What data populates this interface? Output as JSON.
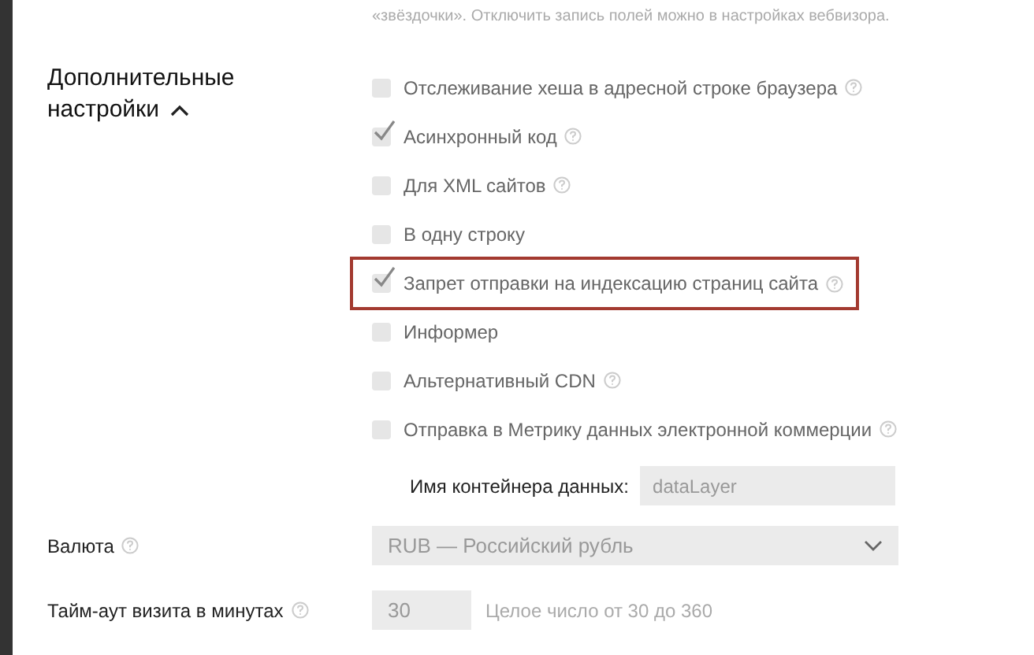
{
  "top_note": "«звёздочки». Отключить запись полей можно в настройках вебвизора.",
  "section": {
    "title": "Дополнительные настройки",
    "expanded": true
  },
  "options": [
    {
      "label": "Отслеживание хеша в адресной строке браузера",
      "checked": false,
      "help": true,
      "highlighted": false
    },
    {
      "label": "Асинхронный код",
      "checked": true,
      "help": true,
      "highlighted": false
    },
    {
      "label": "Для XML сайтов",
      "checked": false,
      "help": true,
      "highlighted": false
    },
    {
      "label": "В одну строку",
      "checked": false,
      "help": false,
      "highlighted": false
    },
    {
      "label": "Запрет отправки на индексацию страниц сайта",
      "checked": true,
      "help": true,
      "highlighted": true
    },
    {
      "label": "Информер",
      "checked": false,
      "help": false,
      "highlighted": false
    },
    {
      "label": "Альтернативный CDN",
      "checked": false,
      "help": true,
      "highlighted": false
    },
    {
      "label": "Отправка в Метрику данных электронной коммерции",
      "checked": false,
      "help": true,
      "highlighted": false
    }
  ],
  "container": {
    "label": "Имя контейнера данных:",
    "value": "dataLayer"
  },
  "currency": {
    "label": "Валюта",
    "value": "RUB — Российский рубль"
  },
  "timeout": {
    "label": "Тайм-аут визита в минутах",
    "value": "30",
    "hint": "Целое число от 30 до 360"
  }
}
